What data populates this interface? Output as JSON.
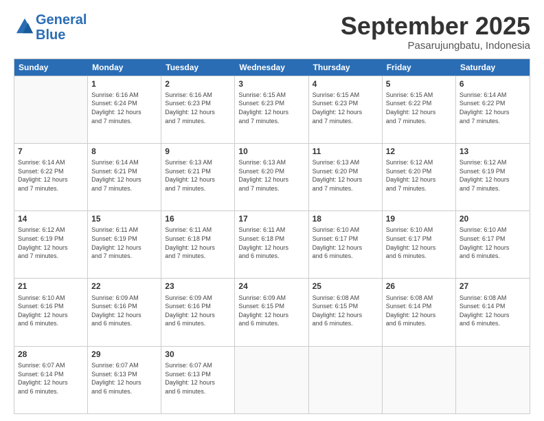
{
  "header": {
    "logo_line1": "General",
    "logo_line2": "Blue",
    "month": "September 2025",
    "location": "Pasarujungbatu, Indonesia"
  },
  "days_of_week": [
    "Sunday",
    "Monday",
    "Tuesday",
    "Wednesday",
    "Thursday",
    "Friday",
    "Saturday"
  ],
  "weeks": [
    [
      {
        "day": "",
        "info": ""
      },
      {
        "day": "1",
        "info": "Sunrise: 6:16 AM\nSunset: 6:24 PM\nDaylight: 12 hours\nand 7 minutes."
      },
      {
        "day": "2",
        "info": "Sunrise: 6:16 AM\nSunset: 6:23 PM\nDaylight: 12 hours\nand 7 minutes."
      },
      {
        "day": "3",
        "info": "Sunrise: 6:15 AM\nSunset: 6:23 PM\nDaylight: 12 hours\nand 7 minutes."
      },
      {
        "day": "4",
        "info": "Sunrise: 6:15 AM\nSunset: 6:23 PM\nDaylight: 12 hours\nand 7 minutes."
      },
      {
        "day": "5",
        "info": "Sunrise: 6:15 AM\nSunset: 6:22 PM\nDaylight: 12 hours\nand 7 minutes."
      },
      {
        "day": "6",
        "info": "Sunrise: 6:14 AM\nSunset: 6:22 PM\nDaylight: 12 hours\nand 7 minutes."
      }
    ],
    [
      {
        "day": "7",
        "info": "Sunrise: 6:14 AM\nSunset: 6:22 PM\nDaylight: 12 hours\nand 7 minutes."
      },
      {
        "day": "8",
        "info": "Sunrise: 6:14 AM\nSunset: 6:21 PM\nDaylight: 12 hours\nand 7 minutes."
      },
      {
        "day": "9",
        "info": "Sunrise: 6:13 AM\nSunset: 6:21 PM\nDaylight: 12 hours\nand 7 minutes."
      },
      {
        "day": "10",
        "info": "Sunrise: 6:13 AM\nSunset: 6:20 PM\nDaylight: 12 hours\nand 7 minutes."
      },
      {
        "day": "11",
        "info": "Sunrise: 6:13 AM\nSunset: 6:20 PM\nDaylight: 12 hours\nand 7 minutes."
      },
      {
        "day": "12",
        "info": "Sunrise: 6:12 AM\nSunset: 6:20 PM\nDaylight: 12 hours\nand 7 minutes."
      },
      {
        "day": "13",
        "info": "Sunrise: 6:12 AM\nSunset: 6:19 PM\nDaylight: 12 hours\nand 7 minutes."
      }
    ],
    [
      {
        "day": "14",
        "info": "Sunrise: 6:12 AM\nSunset: 6:19 PM\nDaylight: 12 hours\nand 7 minutes."
      },
      {
        "day": "15",
        "info": "Sunrise: 6:11 AM\nSunset: 6:19 PM\nDaylight: 12 hours\nand 7 minutes."
      },
      {
        "day": "16",
        "info": "Sunrise: 6:11 AM\nSunset: 6:18 PM\nDaylight: 12 hours\nand 7 minutes."
      },
      {
        "day": "17",
        "info": "Sunrise: 6:11 AM\nSunset: 6:18 PM\nDaylight: 12 hours\nand 6 minutes."
      },
      {
        "day": "18",
        "info": "Sunrise: 6:10 AM\nSunset: 6:17 PM\nDaylight: 12 hours\nand 6 minutes."
      },
      {
        "day": "19",
        "info": "Sunrise: 6:10 AM\nSunset: 6:17 PM\nDaylight: 12 hours\nand 6 minutes."
      },
      {
        "day": "20",
        "info": "Sunrise: 6:10 AM\nSunset: 6:17 PM\nDaylight: 12 hours\nand 6 minutes."
      }
    ],
    [
      {
        "day": "21",
        "info": "Sunrise: 6:10 AM\nSunset: 6:16 PM\nDaylight: 12 hours\nand 6 minutes."
      },
      {
        "day": "22",
        "info": "Sunrise: 6:09 AM\nSunset: 6:16 PM\nDaylight: 12 hours\nand 6 minutes."
      },
      {
        "day": "23",
        "info": "Sunrise: 6:09 AM\nSunset: 6:16 PM\nDaylight: 12 hours\nand 6 minutes."
      },
      {
        "day": "24",
        "info": "Sunrise: 6:09 AM\nSunset: 6:15 PM\nDaylight: 12 hours\nand 6 minutes."
      },
      {
        "day": "25",
        "info": "Sunrise: 6:08 AM\nSunset: 6:15 PM\nDaylight: 12 hours\nand 6 minutes."
      },
      {
        "day": "26",
        "info": "Sunrise: 6:08 AM\nSunset: 6:14 PM\nDaylight: 12 hours\nand 6 minutes."
      },
      {
        "day": "27",
        "info": "Sunrise: 6:08 AM\nSunset: 6:14 PM\nDaylight: 12 hours\nand 6 minutes."
      }
    ],
    [
      {
        "day": "28",
        "info": "Sunrise: 6:07 AM\nSunset: 6:14 PM\nDaylight: 12 hours\nand 6 minutes."
      },
      {
        "day": "29",
        "info": "Sunrise: 6:07 AM\nSunset: 6:13 PM\nDaylight: 12 hours\nand 6 minutes."
      },
      {
        "day": "30",
        "info": "Sunrise: 6:07 AM\nSunset: 6:13 PM\nDaylight: 12 hours\nand 6 minutes."
      },
      {
        "day": "",
        "info": ""
      },
      {
        "day": "",
        "info": ""
      },
      {
        "day": "",
        "info": ""
      },
      {
        "day": "",
        "info": ""
      }
    ]
  ]
}
